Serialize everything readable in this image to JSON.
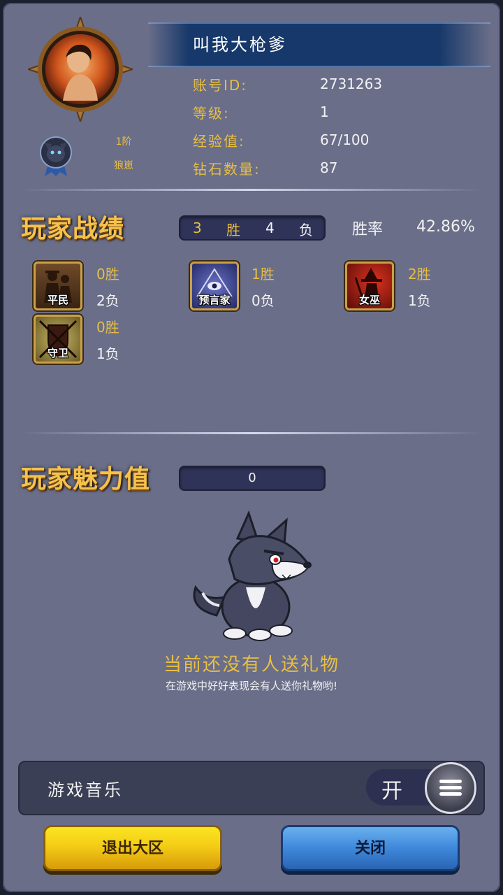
{
  "profile": {
    "nickname": "叫我大枪爹",
    "fields": [
      {
        "label": "账号ID:",
        "value": "2731263"
      },
      {
        "label": "等级:",
        "value": "1"
      },
      {
        "label": "经验值:",
        "value": "67/100"
      },
      {
        "label": "钻石数量:",
        "value": "87"
      }
    ],
    "rank_tier": "1阶",
    "rank_name": "狼崽"
  },
  "record": {
    "title": "玩家战绩",
    "wins": "3",
    "win_label": "胜",
    "losses": "4",
    "loss_label": "负",
    "win_rate_label": "胜率",
    "win_rate": "42.86%",
    "roles": [
      {
        "name": "平民",
        "wins": "0胜",
        "losses": "2负"
      },
      {
        "name": "预言家",
        "wins": "1胜",
        "losses": "0负"
      },
      {
        "name": "女巫",
        "wins": "2胜",
        "losses": "1负"
      },
      {
        "name": "守卫",
        "wins": "0胜",
        "losses": "1负"
      }
    ]
  },
  "charm": {
    "title": "玩家魅力值",
    "value": "0",
    "empty_title": "当前还没有人送礼物",
    "empty_subtitle": "在游戏中好好表现会有人送你礼物哟!"
  },
  "settings": {
    "music_label": "游戏音乐",
    "music_state": "开"
  },
  "buttons": {
    "exit_label": "退出大区",
    "close_label": "关闭"
  },
  "colors": {
    "panel": "#6a6e89",
    "gold_text": "#e8bf43",
    "exit_button": "#f4cc16",
    "close_button": "#3e88da"
  }
}
